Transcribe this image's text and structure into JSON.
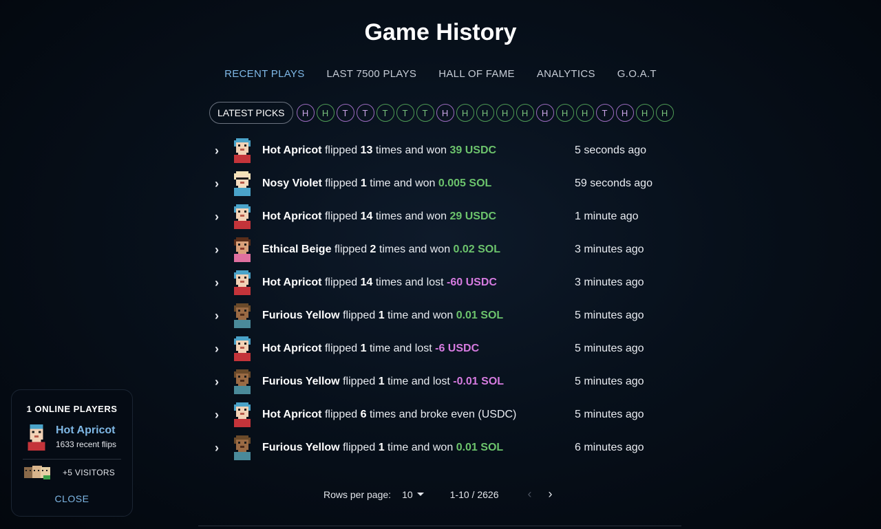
{
  "title": "Game History",
  "tabs": [
    {
      "label": "RECENT PLAYS"
    },
    {
      "label": "LAST 7500 PLAYS"
    },
    {
      "label": "HALL OF FAME"
    },
    {
      "label": "ANALYTICS"
    },
    {
      "label": "G.O.A.T"
    }
  ],
  "picks": {
    "button_label": "LATEST PICKS",
    "items": [
      "H",
      "H",
      "T",
      "T",
      "T",
      "T",
      "T",
      "H",
      "H",
      "H",
      "H",
      "H",
      "H",
      "H",
      "H",
      "T",
      "H",
      "H",
      "H"
    ]
  },
  "plays": [
    {
      "player": "Hot Apricot",
      "verb": "flipped",
      "count": "13",
      "unit": "times and",
      "result": "won",
      "amount": "39 USDC",
      "time": "5 seconds ago"
    },
    {
      "player": "Nosy Violet",
      "verb": "flipped",
      "count": "1",
      "unit": "time and",
      "result": "won",
      "amount": "0.005 SOL",
      "time": "59 seconds ago"
    },
    {
      "player": "Hot Apricot",
      "verb": "flipped",
      "count": "14",
      "unit": "times and",
      "result": "won",
      "amount": "29 USDC",
      "time": "1 minute ago"
    },
    {
      "player": "Ethical Beige",
      "verb": "flipped",
      "count": "2",
      "unit": "times and",
      "result": "won",
      "amount": "0.02 SOL",
      "time": "3 minutes ago"
    },
    {
      "player": "Hot Apricot",
      "verb": "flipped",
      "count": "14",
      "unit": "times and",
      "result": "lost",
      "amount": "-60 USDC",
      "time": "3 minutes ago"
    },
    {
      "player": "Furious Yellow",
      "verb": "flipped",
      "count": "1",
      "unit": "time and",
      "result": "won",
      "amount": "0.01 SOL",
      "time": "5 minutes ago"
    },
    {
      "player": "Hot Apricot",
      "verb": "flipped",
      "count": "1",
      "unit": "time and",
      "result": "lost",
      "amount": "-6 USDC",
      "time": "5 minutes ago"
    },
    {
      "player": "Furious Yellow",
      "verb": "flipped",
      "count": "1",
      "unit": "time and",
      "result": "lost",
      "amount": "-0.01 SOL",
      "time": "5 minutes ago"
    },
    {
      "player": "Hot Apricot",
      "verb": "flipped",
      "count": "6",
      "unit": "times and",
      "result": "broke even",
      "amount": "(USDC)",
      "time": "5 minutes ago"
    },
    {
      "player": "Furious Yellow",
      "verb": "flipped",
      "count": "1",
      "unit": "time and",
      "result": "won",
      "amount": "0.01 SOL",
      "time": "6 minutes ago"
    }
  ],
  "pagination": {
    "rows_label": "Rows per page:",
    "rows_value": "10",
    "range": "1-10 / 2626"
  },
  "online": {
    "header": "1 ONLINE PLAYERS",
    "player_name": "Hot Apricot",
    "player_flips": "1633 recent flips",
    "visitors": "+5 VISITORS",
    "close_label": "CLOSE"
  },
  "colors": {
    "win": "#6cc36c",
    "loss": "#d67be0",
    "accent": "#7fb8e6",
    "heads_default": "#4f9c55",
    "tails": "#9b6bbf"
  }
}
